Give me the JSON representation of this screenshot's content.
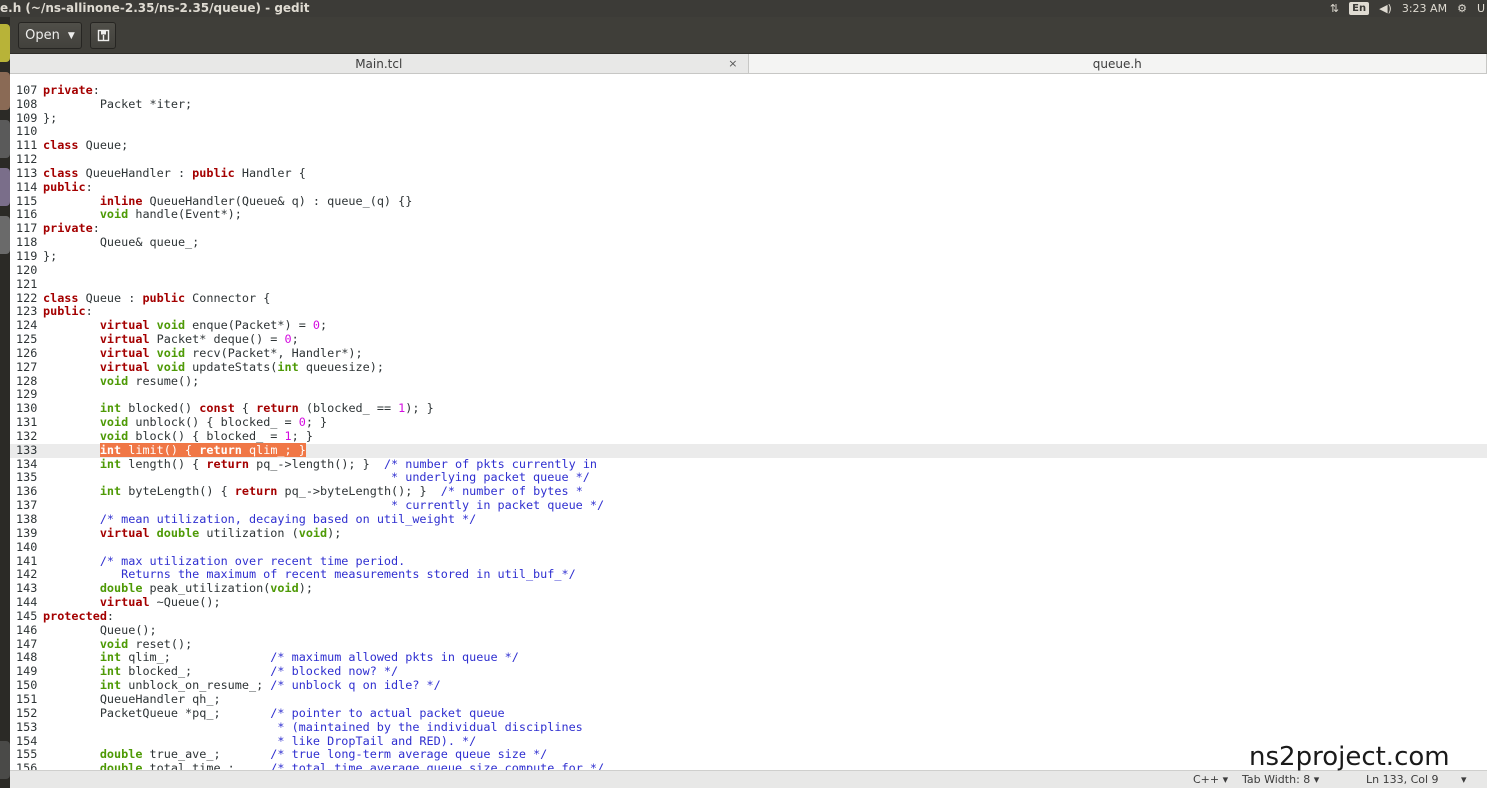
{
  "window": {
    "title": "e.h (~/ns-allinone-2.35/ns-2.35/queue) - gedit"
  },
  "indicators": {
    "network_icon": "updown-arrows-icon",
    "keyboard": "En",
    "volume_icon": "speaker-icon",
    "time": "3:23 AM",
    "settings_icon": "gear-icon",
    "user": "U"
  },
  "toolbar": {
    "open_label": "Open",
    "open_caret": "▼",
    "save_icon": "pin-icon"
  },
  "tabs": [
    {
      "label": "Main.tcl",
      "close": "×"
    },
    {
      "label": "queue.h"
    }
  ],
  "code": {
    "partial_top": "   // ...",
    "lines": [
      {
        "n": "107",
        "t": "private:"
      },
      {
        "n": "108",
        "t": "        Packet *iter;"
      },
      {
        "n": "109",
        "t": "};"
      },
      {
        "n": "110",
        "t": ""
      },
      {
        "n": "111",
        "t": "class Queue;"
      },
      {
        "n": "112",
        "t": ""
      },
      {
        "n": "113",
        "t": "class QueueHandler : public Handler {"
      },
      {
        "n": "114",
        "t": "public:"
      },
      {
        "n": "115",
        "t": "        inline QueueHandler(Queue& q) : queue_(q) {}"
      },
      {
        "n": "116",
        "t": "        void handle(Event*);"
      },
      {
        "n": "117",
        "t": "private:"
      },
      {
        "n": "118",
        "t": "        Queue& queue_;"
      },
      {
        "n": "119",
        "t": "};"
      },
      {
        "n": "120",
        "t": ""
      },
      {
        "n": "121",
        "t": ""
      },
      {
        "n": "122",
        "t": "class Queue : public Connector {"
      },
      {
        "n": "123",
        "t": "public:"
      },
      {
        "n": "124",
        "t": "        virtual void enque(Packet*) = 0;"
      },
      {
        "n": "125",
        "t": "        virtual Packet* deque() = 0;"
      },
      {
        "n": "126",
        "t": "        virtual void recv(Packet*, Handler*);"
      },
      {
        "n": "127",
        "t": "        virtual void updateStats(int queuesize);"
      },
      {
        "n": "128",
        "t": "        void resume();"
      },
      {
        "n": "129",
        "t": ""
      },
      {
        "n": "130",
        "t": "        int blocked() const { return (blocked_ == 1); }"
      },
      {
        "n": "131",
        "t": "        void unblock() { blocked_ = 0; }"
      },
      {
        "n": "132",
        "t": "        void block() { blocked_ = 1; }"
      },
      {
        "n": "133",
        "t": "        int limit() { return qlim_; }"
      },
      {
        "n": "134",
        "t": "        int length() { return pq_->length(); }  /* number of pkts currently in"
      },
      {
        "n": "135",
        "t": "                                                 * underlying packet queue */"
      },
      {
        "n": "136",
        "t": "        int byteLength() { return pq_->byteLength(); }  /* number of bytes *"
      },
      {
        "n": "137",
        "t": "                                                 * currently in packet queue */"
      },
      {
        "n": "138",
        "t": "        /* mean utilization, decaying based on util_weight */"
      },
      {
        "n": "139",
        "t": "        virtual double utilization (void);"
      },
      {
        "n": "140",
        "t": ""
      },
      {
        "n": "141",
        "t": "        /* max utilization over recent time period."
      },
      {
        "n": "142",
        "t": "           Returns the maximum of recent measurements stored in util_buf_*/"
      },
      {
        "n": "143",
        "t": "        double peak_utilization(void);"
      },
      {
        "n": "144",
        "t": "        virtual ~Queue();"
      },
      {
        "n": "145",
        "t": "protected:"
      },
      {
        "n": "146",
        "t": "        Queue();"
      },
      {
        "n": "147",
        "t": "        void reset();"
      },
      {
        "n": "148",
        "t": "        int qlim_;              /* maximum allowed pkts in queue */"
      },
      {
        "n": "149",
        "t": "        int blocked_;           /* blocked now? */"
      },
      {
        "n": "150",
        "t": "        int unblock_on_resume_; /* unblock q on idle? */"
      },
      {
        "n": "151",
        "t": "        QueueHandler qh_;"
      },
      {
        "n": "152",
        "t": "        PacketQueue *pq_;       /* pointer to actual packet queue"
      },
      {
        "n": "153",
        "t": "                                 * (maintained by the individual disciplines"
      },
      {
        "n": "154",
        "t": "                                 * like DropTail and RED). */"
      },
      {
        "n": "155",
        "t": "        double true_ave_;       /* true long-term average queue size */"
      },
      {
        "n": "156",
        "t": "        double total_time_;     /* total time average queue size compute for */"
      }
    ]
  },
  "status": {
    "language": "C++ ▾",
    "tab_width": "Tab Width: 8 ▾",
    "position": "Ln 133, Col 9",
    "menu_caret": "▾"
  },
  "watermark": "ns2project.com",
  "colors": {
    "keyword": "#a40000",
    "type": "#4e9a06",
    "number": "#d40ae0",
    "comment": "#2f2fd0",
    "selection": "#f07746"
  }
}
